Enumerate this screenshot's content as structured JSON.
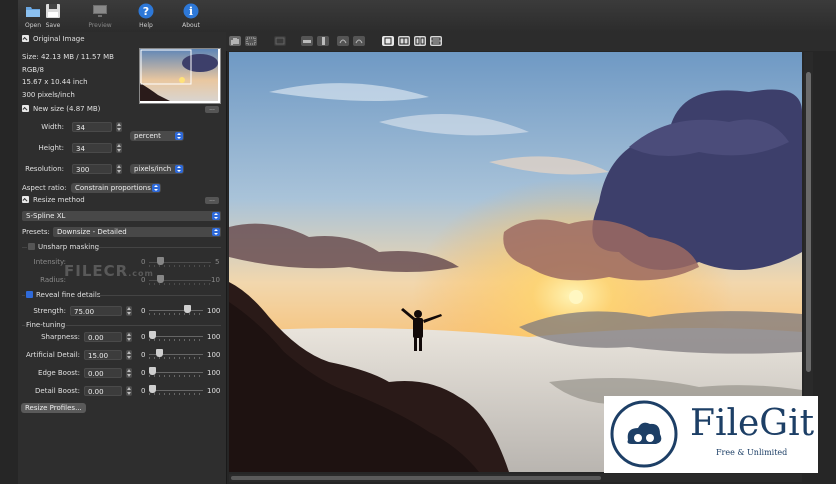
{
  "toolbar": {
    "buttons": [
      {
        "label": "Open",
        "icon": "folder-icon"
      },
      {
        "label": "Save",
        "icon": "floppy-disk-icon"
      },
      {
        "label": "Preview",
        "icon": "monitor-icon"
      },
      {
        "label": "Help",
        "icon": "question-icon"
      },
      {
        "label": "About",
        "icon": "info-icon"
      }
    ]
  },
  "original_image": {
    "title": "Original Image",
    "size": "Size: 42.13 MB / 11.57 MB",
    "mode": "RGB/8",
    "dimensions": "15.67 x 10.44 inch",
    "resolution": "300 pixels/inch"
  },
  "new_size": {
    "title": "New size (4.87 MB)",
    "width_label": "Width:",
    "width_value": "34",
    "height_label": "Height:",
    "height_value": "34",
    "unit": "percent",
    "resolution_label": "Resolution:",
    "resolution_value": "300",
    "resolution_unit": "pixels/inch",
    "aspect_label": "Aspect ratio:",
    "aspect_value": "Constrain proportions"
  },
  "resize_method": {
    "title": "Resize method",
    "method": "S-Spline XL",
    "presets_label": "Presets:",
    "presets_value": "Downsize - Detailed",
    "unsharp": {
      "label": "Unsharp masking",
      "intensity_label": "Intensity:",
      "intensity_min": "0",
      "intensity_max": "5",
      "radius_label": "Radius:",
      "radius_min": "0",
      "radius_max": "10"
    },
    "reveal": {
      "label": "Reveal fine details",
      "strength_label": "Strength:",
      "strength_value": "75.00",
      "min": "0",
      "max": "100",
      "level": 0.75
    },
    "finetuning": {
      "title": "Fine-tuning",
      "rows": [
        {
          "label": "Sharpness:",
          "value": "0.00",
          "min": "0",
          "max": "100",
          "level": 0.0
        },
        {
          "label": "Artificial Detail:",
          "value": "15.00",
          "min": "0",
          "max": "100",
          "level": 0.15
        },
        {
          "label": "Edge Boost:",
          "value": "0.00",
          "min": "0",
          "max": "100",
          "level": 0.0
        },
        {
          "label": "Detail Boost:",
          "value": "0.00",
          "min": "0",
          "max": "100",
          "level": 0.0
        }
      ]
    },
    "profiles_button": "Resize Profiles..."
  },
  "watermarks": {
    "filecr": "FILECR",
    "filecr_sub": ".com",
    "filegit": "FileGit",
    "filegit_tagline": "Free & Unlimited"
  },
  "colors": {
    "accent": "#2f6ad9",
    "checkbox_checked": "#2f6ad9"
  }
}
